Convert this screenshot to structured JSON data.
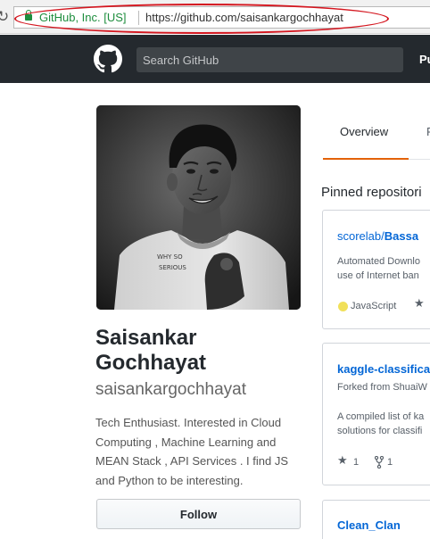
{
  "browser": {
    "reload_glyph": "↻",
    "cert_name": "GitHub, Inc. [US]",
    "url": "https://github.com/saisankargochhayat"
  },
  "header": {
    "search_placeholder": "Search GitHub",
    "nav_link": "Pu"
  },
  "profile": {
    "name_line1": "Saisankar",
    "name_line2": "Gochhayat",
    "username": "saisankargochhayat",
    "bio": "Tech Enthusiast. Interested in Cloud Computing , Machine Learning and MEAN Stack , API Services . I find JS and Python to be interesting.",
    "follow_label": "Follow"
  },
  "tabs": {
    "overview": "Overview",
    "next": "R"
  },
  "pinned": {
    "heading": "Pinned repositori",
    "repos": [
      {
        "owner": "scorelab/",
        "name": "Bassa",
        "desc_line1": "Automated Downlo",
        "desc_line2": "use of Internet ban",
        "language": "JavaScript",
        "language_color": "#f1e05a"
      },
      {
        "name": "kaggle-classifica",
        "forked_from": "Forked from ShuaiW",
        "desc_line1": "A compiled list of ka",
        "desc_line2": "solutions for classifi",
        "stars": "1",
        "forks": "1"
      },
      {
        "name": "Clean_Clan"
      }
    ]
  },
  "colors": {
    "header_bg": "#24292e",
    "link_blue": "#0366d6",
    "tab_accent": "#e36209",
    "secure_green": "#1e8e3e",
    "annotation_red": "#d4161f"
  }
}
